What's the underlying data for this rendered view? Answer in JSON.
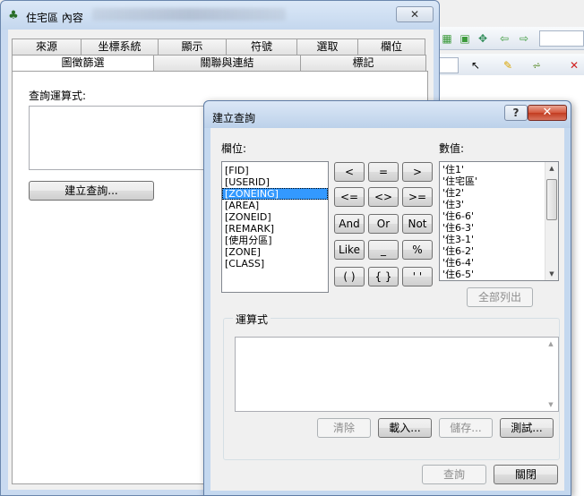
{
  "background_app": {
    "toolbar_icons": [
      "grid-icon",
      "grid-select-icon",
      "pan-arrows-icon",
      "back-arrow-icon",
      "forward-arrow-icon",
      "select-cursor-icon",
      "pencil-icon",
      "measure-icon",
      "delete-x-icon"
    ]
  },
  "properties_window": {
    "title": "住宅區 內容",
    "close_glyph": "✕",
    "tabs_row1": [
      "來源",
      "坐標系統",
      "顯示",
      "符號",
      "選取",
      "欄位"
    ],
    "tabs_row2": [
      "圖徵篩選",
      "關聯與連結",
      "標記"
    ],
    "active_tab": "圖徵篩選",
    "query_label": "查詢運算式:",
    "build_query_button": "建立查詢..."
  },
  "query_dialog": {
    "title": "建立查詢",
    "help_glyph": "?",
    "close_glyph": "✕",
    "fields_label": "欄位:",
    "fields": [
      "[FID]",
      "[USERID]",
      "[ZONEING]",
      "[AREA]",
      "[ZONEID]",
      "[REMARK]",
      "[使用分區]",
      "[ZONE]",
      "[CLASS]"
    ],
    "selected_field": "[ZONEING]",
    "operators": [
      "<",
      "=",
      ">",
      "<=",
      "<>",
      ">=",
      "And",
      "Or",
      "Not",
      "Like",
      "_",
      "%",
      "( )",
      "{ }",
      "' '"
    ],
    "values_label": "數值:",
    "values": [
      "'住1'",
      "'住宅區'",
      "'住2'",
      "'住3'",
      "'住6-6'",
      "'住6-3'",
      "'住3-1'",
      "'住6-2'",
      "'住6-4'",
      "'住6-5'"
    ],
    "list_all_button": "全部列出",
    "expression_label": "運算式",
    "expression_value": "",
    "clear_button": "清除",
    "load_button": "載入...",
    "save_button": "儲存...",
    "test_button": "測試...",
    "query_button": "查詢",
    "close_button": "關閉"
  }
}
